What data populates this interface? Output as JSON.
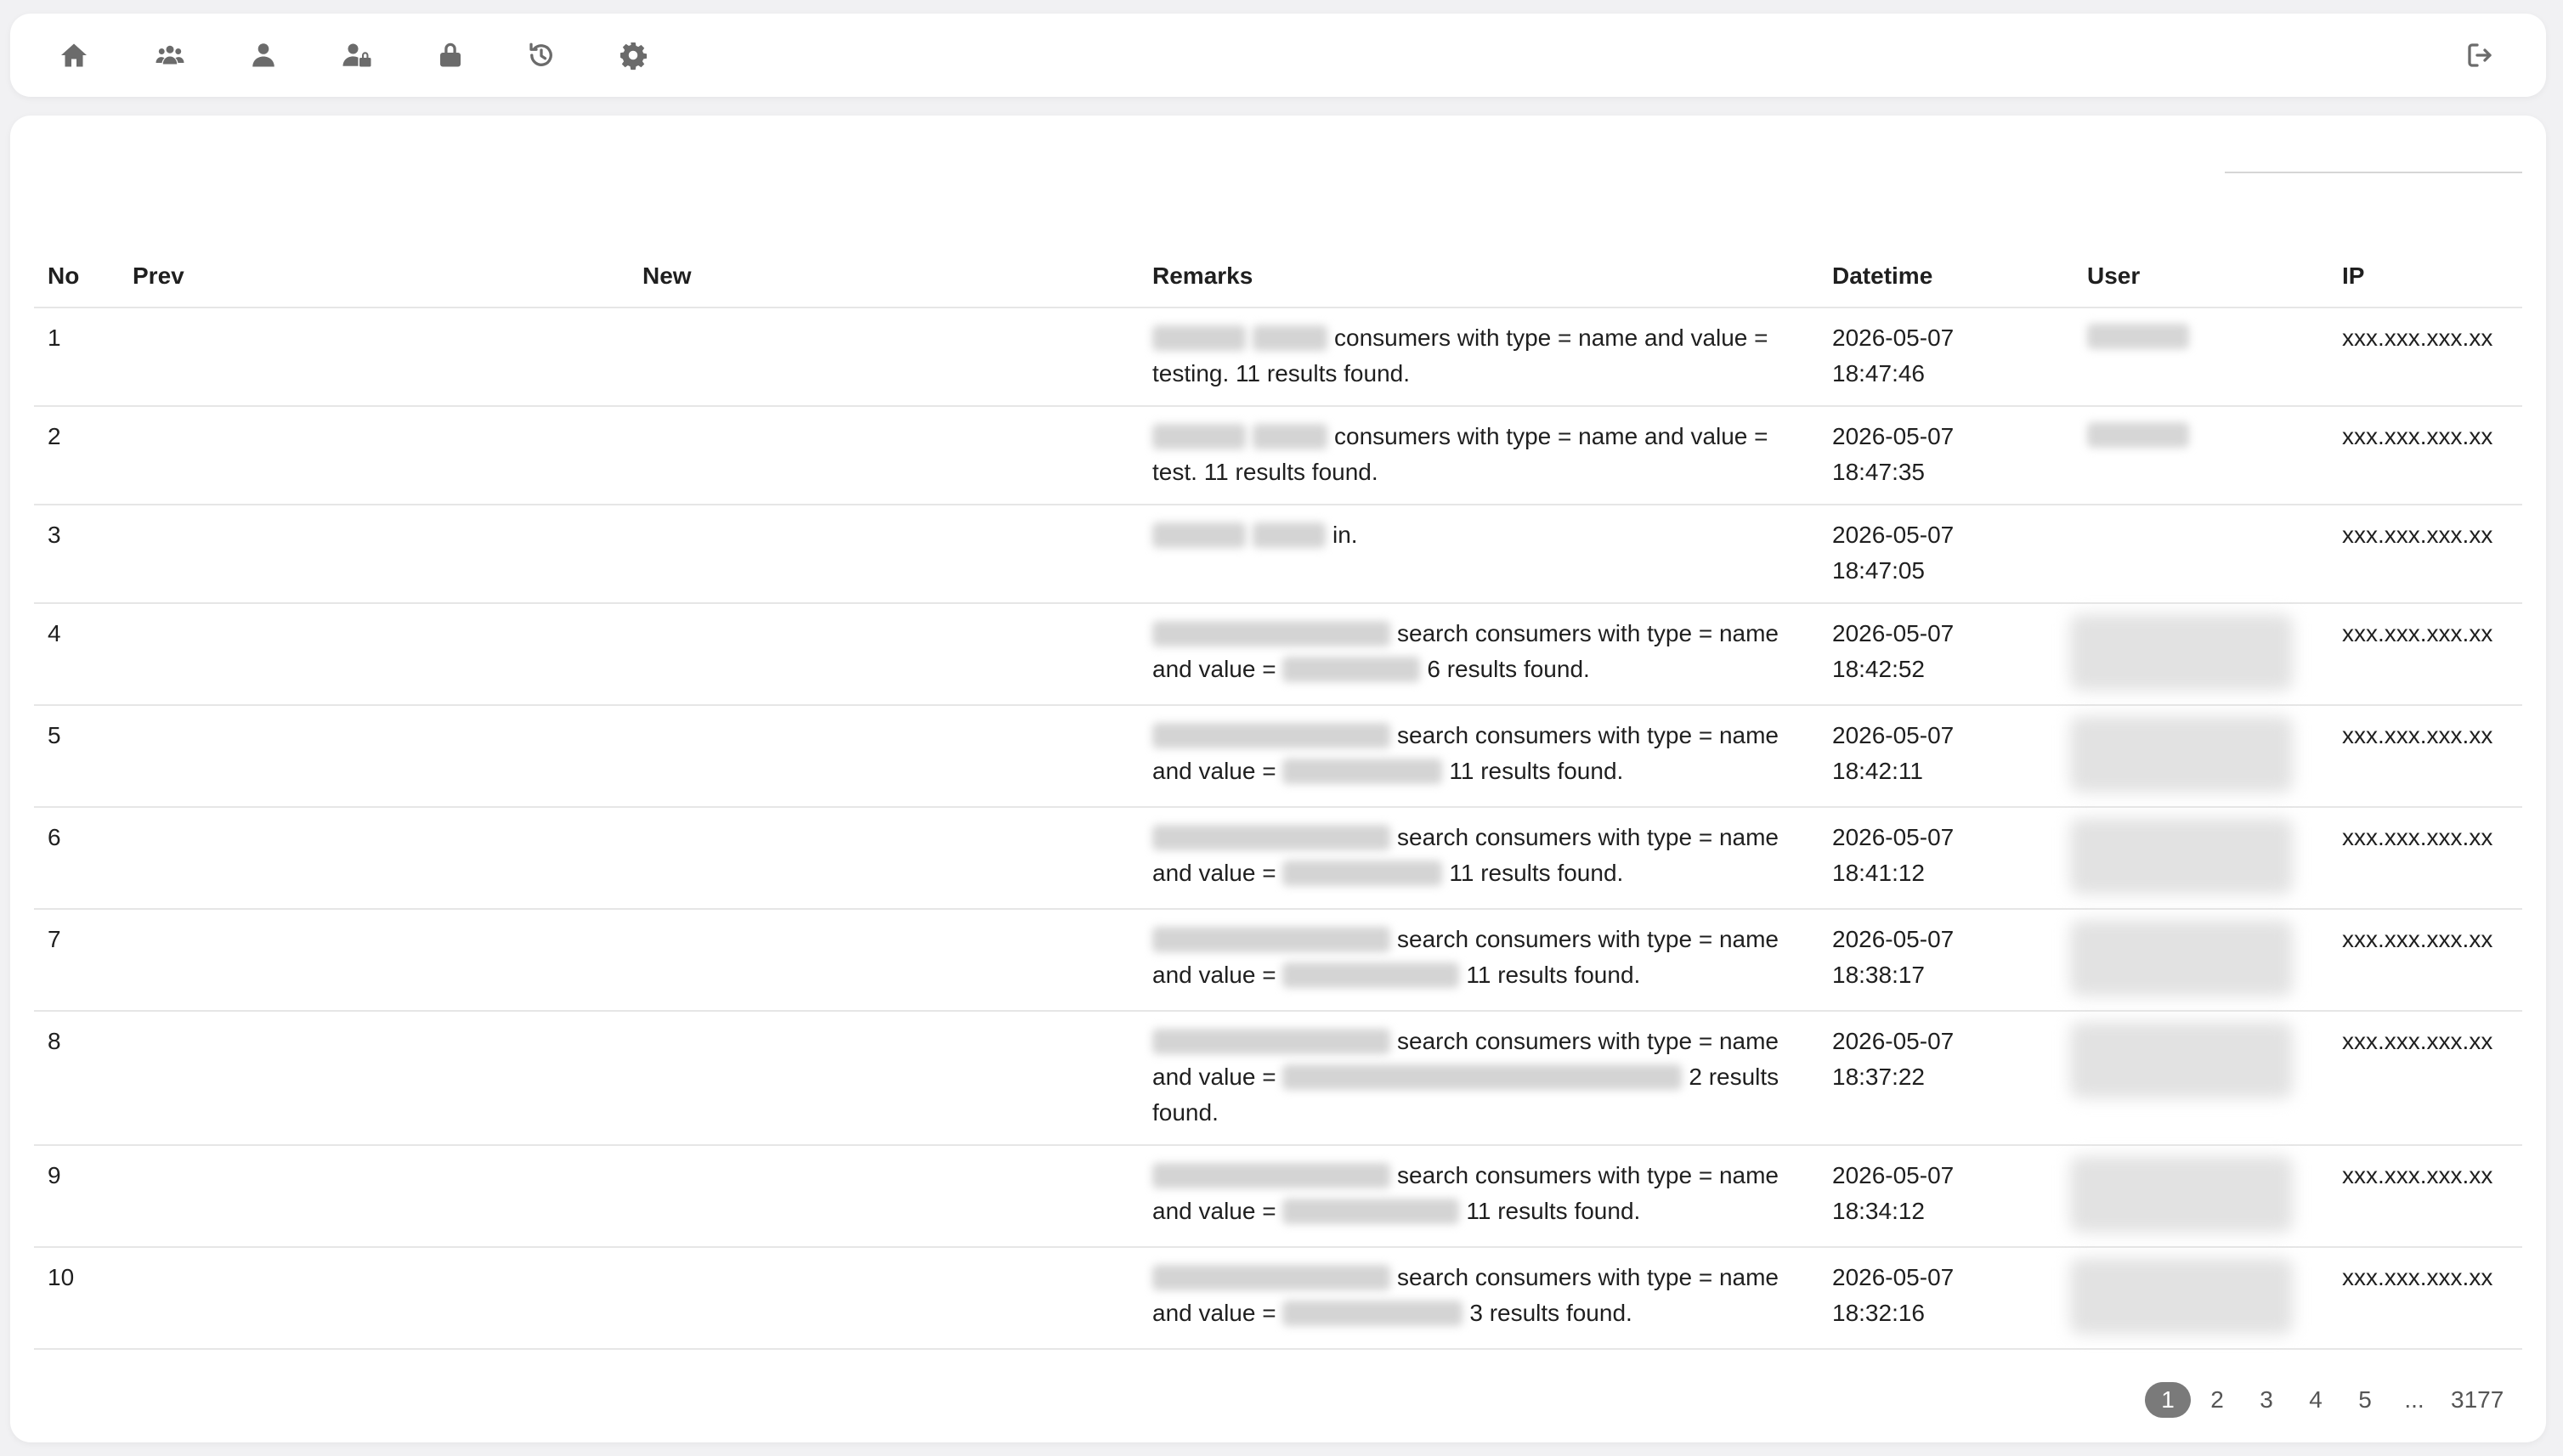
{
  "nav": {
    "icons": [
      "home-icon",
      "users-icon",
      "user-icon",
      "user-lock-icon",
      "lock-icon",
      "history-icon",
      "gear-icon"
    ],
    "logout": "logout-icon"
  },
  "search": {
    "placeholder": ""
  },
  "table": {
    "headers": {
      "no": "No",
      "prev": "Prev",
      "new": "New",
      "remarks": "Remarks",
      "datetime": "Datetime",
      "user": "User",
      "ip": "IP"
    },
    "rows": [
      {
        "no": "1",
        "remarks_text": "consumers with type = name and value = testing. 11 results found.",
        "date": "2026-05-07",
        "time": "18:47:46",
        "ip": "xxx.xxx.xxx.xx"
      },
      {
        "no": "2",
        "remarks_text": "consumers with type = name and value = test. 11 results found.",
        "date": "2026-05-07",
        "time": "18:47:35",
        "ip": "xxx.xxx.xxx.xx"
      },
      {
        "no": "3",
        "remarks_text": "in.",
        "date": "2026-05-07",
        "time": "18:47:05",
        "ip": "xxx.xxx.xxx.xx"
      },
      {
        "no": "4",
        "remarks_text": "search consumers with type = name",
        "remarks_value_label": "and value =",
        "remarks_suffix": "6 results found.",
        "date": "2026-05-07",
        "time": "18:42:52",
        "ip": "xxx.xxx.xxx.xx"
      },
      {
        "no": "5",
        "remarks_text": "search consumers with type = name",
        "remarks_value_label": "and value =",
        "remarks_suffix": "11 results found.",
        "date": "2026-05-07",
        "time": "18:42:11",
        "ip": "xxx.xxx.xxx.xx"
      },
      {
        "no": "6",
        "remarks_text": "search consumers with type = name",
        "remarks_value_label": "and value =",
        "remarks_suffix": "11 results found.",
        "date": "2026-05-07",
        "time": "18:41:12",
        "ip": "xxx.xxx.xxx.xx"
      },
      {
        "no": "7",
        "remarks_text": "search consumers with type = name",
        "remarks_value_label": "and value =",
        "remarks_suffix": "11 results found.",
        "date": "2026-05-07",
        "time": "18:38:17",
        "ip": "xxx.xxx.xxx.xx"
      },
      {
        "no": "8",
        "remarks_text": "search consumers with type = name",
        "remarks_value_label": "and value =",
        "remarks_suffix": "2 results found.",
        "date": "2026-05-07",
        "time": "18:37:22",
        "ip": "xxx.xxx.xxx.xx"
      },
      {
        "no": "9",
        "remarks_text": "search consumers with type = name",
        "remarks_value_label": "and value =",
        "remarks_suffix": "11 results found.",
        "date": "2026-05-07",
        "time": "18:34:12",
        "ip": "xxx.xxx.xxx.xx"
      },
      {
        "no": "10",
        "remarks_text": "search consumers with type = name",
        "remarks_value_label": "and value =",
        "remarks_suffix": "3 results found.",
        "date": "2026-05-07",
        "time": "18:32:16",
        "ip": "xxx.xxx.xxx.xx"
      }
    ]
  },
  "pagination": {
    "pages": [
      "1",
      "2",
      "3",
      "4",
      "5"
    ],
    "ellipsis": "...",
    "last": "3177",
    "active": "1"
  }
}
